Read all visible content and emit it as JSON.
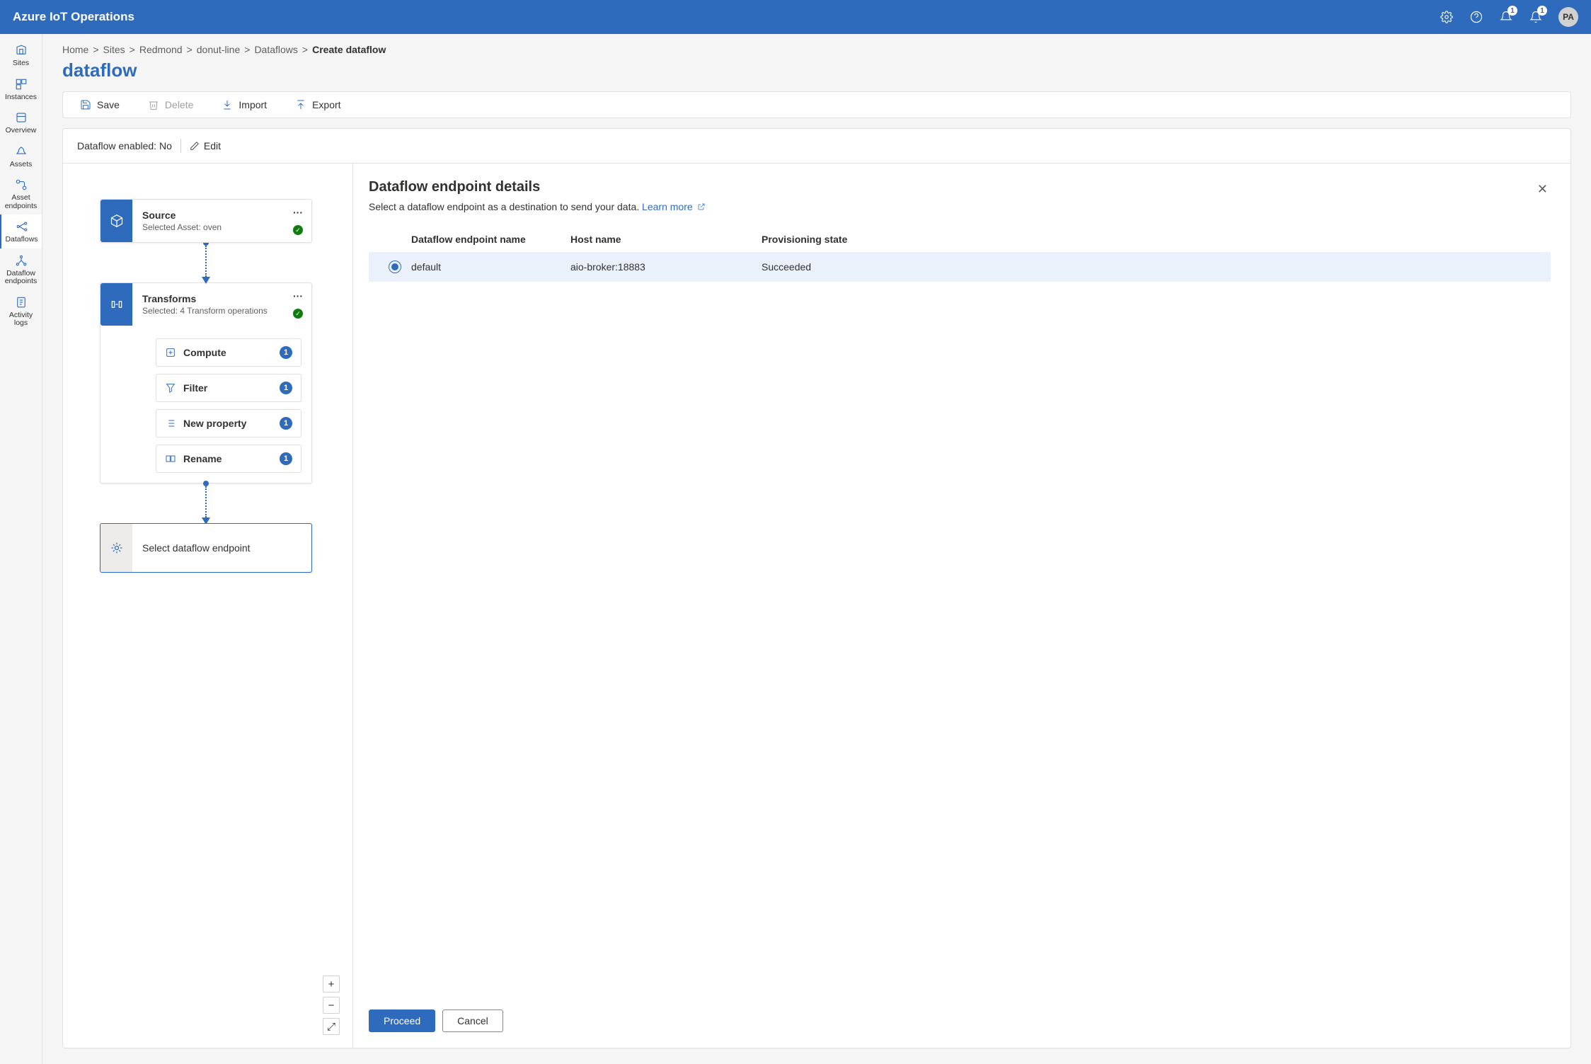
{
  "header": {
    "title": "Azure IoT Operations",
    "feedback_badge": "1",
    "notifications_badge": "1",
    "avatar": "PA"
  },
  "sidebar": {
    "items": [
      {
        "label": "Sites"
      },
      {
        "label": "Instances"
      },
      {
        "label": "Overview"
      },
      {
        "label": "Assets"
      },
      {
        "label": "Asset endpoints"
      },
      {
        "label": "Dataflows"
      },
      {
        "label": "Dataflow endpoints"
      },
      {
        "label": "Activity logs"
      }
    ]
  },
  "breadcrumbs": [
    "Home",
    "Sites",
    "Redmond",
    "donut-line",
    "Dataflows",
    "Create dataflow"
  ],
  "page_title": "dataflow",
  "toolbar": {
    "save": "Save",
    "delete": "Delete",
    "import": "Import",
    "export": "Export"
  },
  "status": {
    "label": "Dataflow enabled:",
    "value": "No",
    "edit": "Edit"
  },
  "graph": {
    "source": {
      "title": "Source",
      "subtitle": "Selected Asset: oven"
    },
    "transforms": {
      "title": "Transforms",
      "subtitle": "Selected: 4 Transform operations",
      "items": [
        {
          "label": "Compute",
          "count": "1"
        },
        {
          "label": "Filter",
          "count": "1"
        },
        {
          "label": "New property",
          "count": "1"
        },
        {
          "label": "Rename",
          "count": "1"
        }
      ]
    },
    "endpoint": {
      "label": "Select dataflow endpoint"
    }
  },
  "zoom": {
    "in": "+",
    "out": "−",
    "fit": "⤢"
  },
  "panel": {
    "title": "Dataflow endpoint details",
    "desc": "Select a dataflow endpoint as a destination to send your data.",
    "learn_more": "Learn more",
    "columns": {
      "name": "Dataflow endpoint name",
      "host": "Host name",
      "state": "Provisioning state"
    },
    "row": {
      "name": "default",
      "host": "aio-broker:18883",
      "state": "Succeeded"
    },
    "proceed": "Proceed",
    "cancel": "Cancel"
  }
}
